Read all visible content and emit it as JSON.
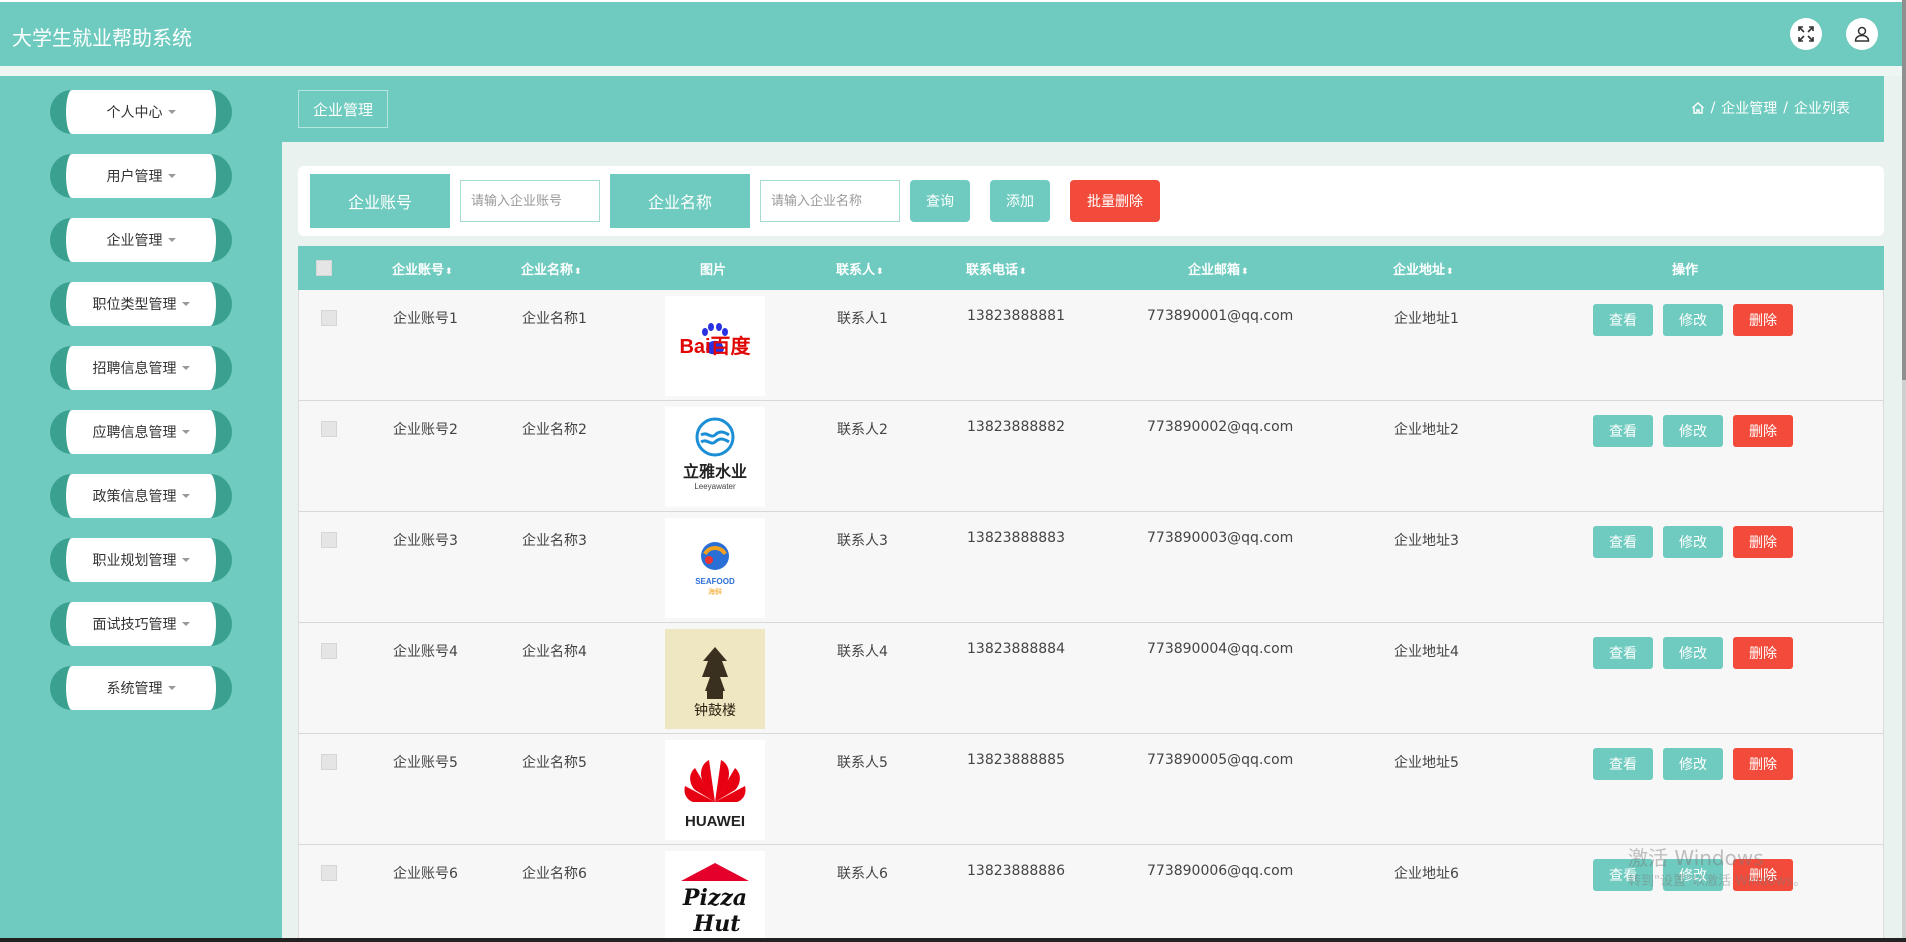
{
  "app": {
    "title": "大学生就业帮助系统"
  },
  "topbar": {
    "fullscreen_icon": "expand-icon",
    "user_icon": "user-icon"
  },
  "sidebar": {
    "items": [
      {
        "label": "个人中心"
      },
      {
        "label": "用户管理"
      },
      {
        "label": "企业管理"
      },
      {
        "label": "职位类型管理"
      },
      {
        "label": "招聘信息管理"
      },
      {
        "label": "应聘信息管理"
      },
      {
        "label": "政策信息管理"
      },
      {
        "label": "职业规划管理"
      },
      {
        "label": "面试技巧管理"
      },
      {
        "label": "系统管理"
      }
    ]
  },
  "page": {
    "header_label": "企业管理",
    "breadcrumb": {
      "home_icon": "home-icon",
      "sep": "/",
      "level1": "企业管理",
      "level2": "企业列表"
    }
  },
  "search": {
    "account_label": "企业账号",
    "account_placeholder": "请输入企业账号",
    "name_label": "企业名称",
    "name_placeholder": "请输入企业名称",
    "query_btn": "查询",
    "add_btn": "添加",
    "batch_delete_btn": "批量删除"
  },
  "table": {
    "headers": {
      "account": "企业账号",
      "name": "企业名称",
      "image": "图片",
      "contact": "联系人",
      "phone": "联系电话",
      "email": "企业邮箱",
      "address": "企业地址",
      "ops": "操作"
    },
    "sort_icon": "⬍",
    "view_btn": "查看",
    "edit_btn": "修改",
    "delete_btn": "删除",
    "rows": [
      {
        "account": "企业账号1",
        "name": "企业名称1",
        "logo": "baidu-logo",
        "contact": "联系人1",
        "phone": "13823888881",
        "email": "773890001@qq.com",
        "address": "企业地址1"
      },
      {
        "account": "企业账号2",
        "name": "企业名称2",
        "logo": "leeyawater-logo",
        "contact": "联系人2",
        "phone": "13823888882",
        "email": "773890002@qq.com",
        "address": "企业地址2"
      },
      {
        "account": "企业账号3",
        "name": "企业名称3",
        "logo": "seafood-logo",
        "contact": "联系人3",
        "phone": "13823888883",
        "email": "773890003@qq.com",
        "address": "企业地址3"
      },
      {
        "account": "企业账号4",
        "name": "企业名称4",
        "logo": "tower-logo",
        "contact": "联系人4",
        "phone": "13823888884",
        "email": "773890004@qq.com",
        "address": "企业地址4"
      },
      {
        "account": "企业账号5",
        "name": "企业名称5",
        "logo": "huawei-logo",
        "contact": "联系人5",
        "phone": "13823888885",
        "email": "773890005@qq.com",
        "address": "企业地址5"
      },
      {
        "account": "企业账号6",
        "name": "企业名称6",
        "logo": "pizzahut-logo",
        "contact": "联系人6",
        "phone": "13823888886",
        "email": "773890006@qq.com",
        "address": "企业地址6"
      }
    ]
  },
  "logo_text": {
    "baidu": "Bai百度",
    "leeya_cn": "立雅水业",
    "leeya_en": "Leeyawater",
    "seafood_en": "SEAFOOD",
    "seafood_cn": "海鲜",
    "tower_cn": "钟鼓楼",
    "huawei": "HUAWEI",
    "pizzahut_1": "Pizza",
    "pizzahut_2": "Hut"
  },
  "watermark": {
    "line1": "激活 Windows",
    "line2": "转到\"设置\"以激活 Windows。"
  },
  "colors": {
    "primary": "#6fcbbf",
    "sidebar_accent": "#3aa08f",
    "danger": "#f34b3b"
  }
}
